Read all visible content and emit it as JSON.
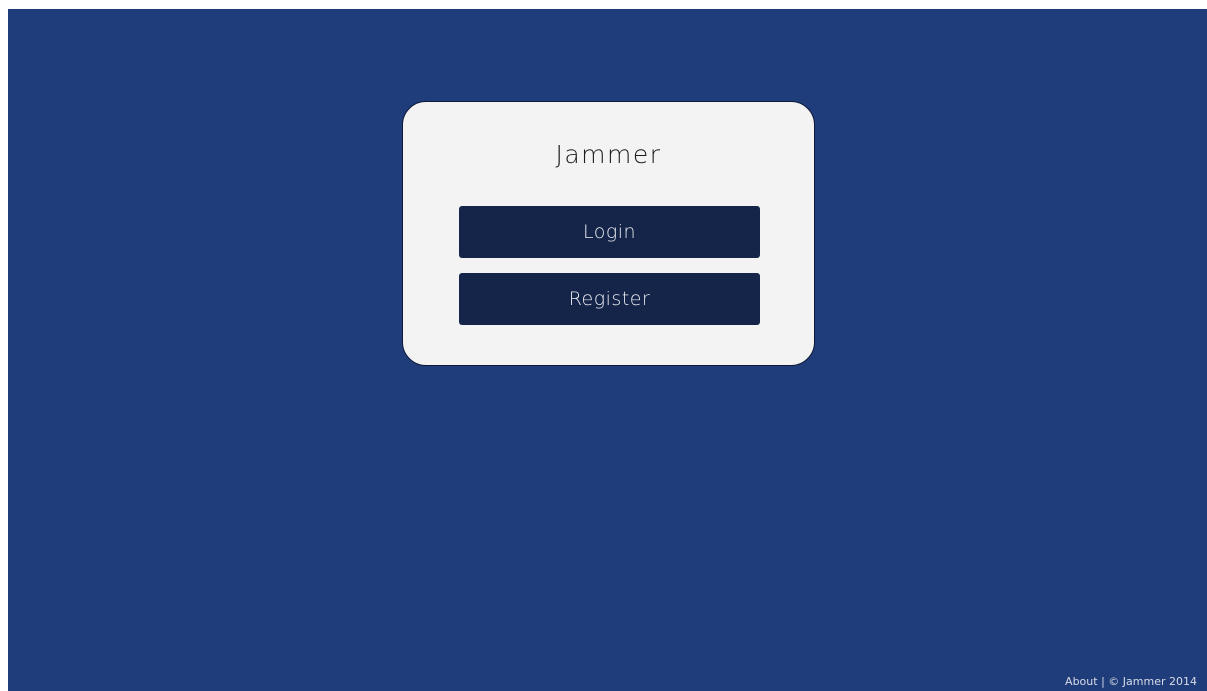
{
  "app": {
    "title": "Jammer"
  },
  "actions": {
    "login_label": "Login",
    "register_label": "Register"
  },
  "footer": {
    "about_label": "About",
    "separator": "|",
    "copyright": "© Jammer 2014"
  },
  "colors": {
    "background": "#203d7b",
    "card": "#f3f3f4",
    "button": "#152549"
  }
}
